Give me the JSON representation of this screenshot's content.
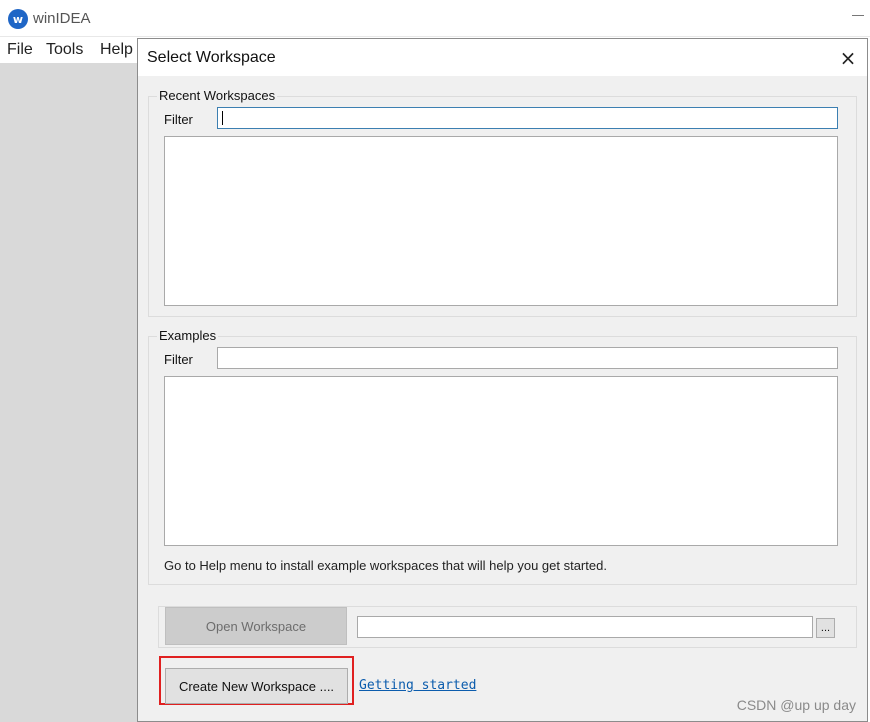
{
  "app": {
    "title": "winIDEA",
    "logo_text": "w",
    "menu": [
      {
        "label": "File"
      },
      {
        "label": "Tools"
      },
      {
        "label": "Help"
      }
    ]
  },
  "dialog": {
    "title": "Select Workspace",
    "close_icon": "×",
    "recent": {
      "legend": "Recent Workspaces",
      "filter_label": "Filter",
      "filter_value": ""
    },
    "examples": {
      "legend": "Examples",
      "filter_label": "Filter",
      "filter_value": "",
      "hint": "Go to Help menu to install example workspaces that will help you get started."
    },
    "open_workspace_label": "Open Workspace",
    "path_value": "",
    "browse_label": "...",
    "create_new_label": "Create New Workspace ....",
    "getting_started_label": "Getting started"
  },
  "watermark": "CSDN @up up day",
  "colors": {
    "highlight": "#e02020",
    "link": "#0b5cad",
    "logo": "#1f66c6"
  }
}
